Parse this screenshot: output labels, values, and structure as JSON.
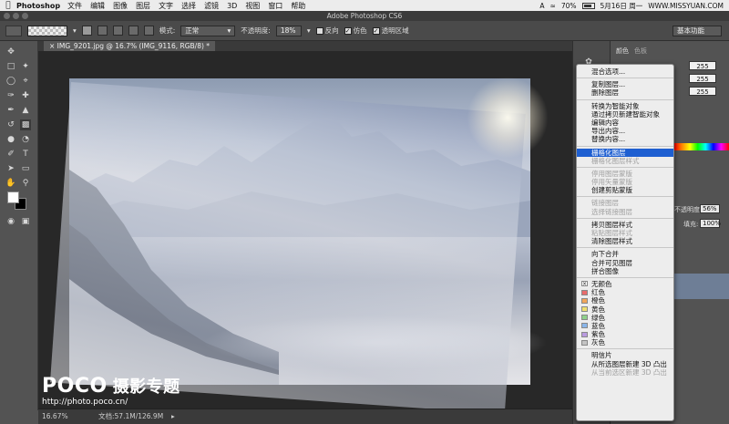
{
  "menubar": {
    "app_name": "Photoshop",
    "items": [
      "文件",
      "编辑",
      "图像",
      "图层",
      "文字",
      "选择",
      "滤镜",
      "3D",
      "视图",
      "窗口",
      "帮助"
    ],
    "battery": "70%",
    "datetime": "5月16日 周一",
    "site": "WWW.MISSYUAN.COM"
  },
  "window": {
    "title": "Adobe Photoshop CS6"
  },
  "options": {
    "mode_label": "模式:",
    "mode_value": "正常",
    "opacity_label": "不透明度:",
    "opacity_value": "18%",
    "reverse_label": "反向",
    "dither_label": "仿色",
    "transparency_label": "透明区域",
    "workspace_label": "基本功能"
  },
  "document": {
    "tab_label": "IMG_9201.jpg @ 16.7% (IMG_9116, RGB/8) *"
  },
  "watermark": {
    "brand": "POCO",
    "brand_cn": "摄影专题",
    "url": "http://photo.poco.cn/"
  },
  "status": {
    "zoom": "16.67%",
    "doc_info": "文档:57.1M/126.9M"
  },
  "panels": {
    "color_tab": "颜色",
    "swatches_tab": "色板",
    "r_value": "255",
    "g_value": "255",
    "b_value": "255",
    "opacity_label": "不透明度:",
    "opacity_value": "56%",
    "fill_label": "填充:",
    "fill_value": "100%"
  },
  "context_menu": {
    "items": [
      {
        "label": "混合选项...",
        "state": "normal"
      },
      {
        "sep": true
      },
      {
        "label": "复制图层...",
        "state": "normal"
      },
      {
        "label": "删除图层",
        "state": "normal"
      },
      {
        "sep": true
      },
      {
        "label": "转换为智能对象",
        "state": "normal"
      },
      {
        "label": "通过拷贝新建智能对象",
        "state": "normal"
      },
      {
        "label": "编辑内容",
        "state": "normal"
      },
      {
        "label": "导出内容...",
        "state": "normal"
      },
      {
        "label": "替换内容...",
        "state": "normal"
      },
      {
        "sep": true
      },
      {
        "label": "栅格化图层",
        "state": "highlighted"
      },
      {
        "label": "栅格化图层样式",
        "state": "disabled"
      },
      {
        "sep": true
      },
      {
        "label": "停用图层蒙版",
        "state": "disabled"
      },
      {
        "label": "停用矢量蒙版",
        "state": "disabled"
      },
      {
        "label": "创建剪贴蒙版",
        "state": "normal"
      },
      {
        "sep": true
      },
      {
        "label": "链接图层",
        "state": "disabled"
      },
      {
        "label": "选择链接图层",
        "state": "disabled"
      },
      {
        "sep": true
      },
      {
        "label": "拷贝图层样式",
        "state": "normal"
      },
      {
        "label": "粘贴图层样式",
        "state": "disabled"
      },
      {
        "label": "清除图层样式",
        "state": "normal"
      },
      {
        "sep": true
      },
      {
        "label": "向下合并",
        "state": "normal"
      },
      {
        "label": "合并可见图层",
        "state": "normal"
      },
      {
        "label": "拼合图像",
        "state": "normal"
      },
      {
        "sep": true
      },
      {
        "label": "无颜色",
        "state": "normal",
        "swatch": "none"
      },
      {
        "label": "红色",
        "state": "normal",
        "swatch": "#e86b6b"
      },
      {
        "label": "橙色",
        "state": "normal",
        "swatch": "#f2a65a"
      },
      {
        "label": "黄色",
        "state": "normal",
        "swatch": "#f0e070"
      },
      {
        "label": "绿色",
        "state": "normal",
        "swatch": "#8fd08a"
      },
      {
        "label": "蓝色",
        "state": "normal",
        "swatch": "#8ab6ea"
      },
      {
        "label": "紫色",
        "state": "normal",
        "swatch": "#b99ae0"
      },
      {
        "label": "灰色",
        "state": "normal",
        "swatch": "#c4c4c4"
      },
      {
        "sep": true
      },
      {
        "label": "明信片",
        "state": "normal"
      },
      {
        "label": "从所选图层新建 3D 凸出",
        "state": "normal"
      },
      {
        "label": "从当前选区新建 3D 凸出",
        "state": "disabled"
      }
    ]
  }
}
